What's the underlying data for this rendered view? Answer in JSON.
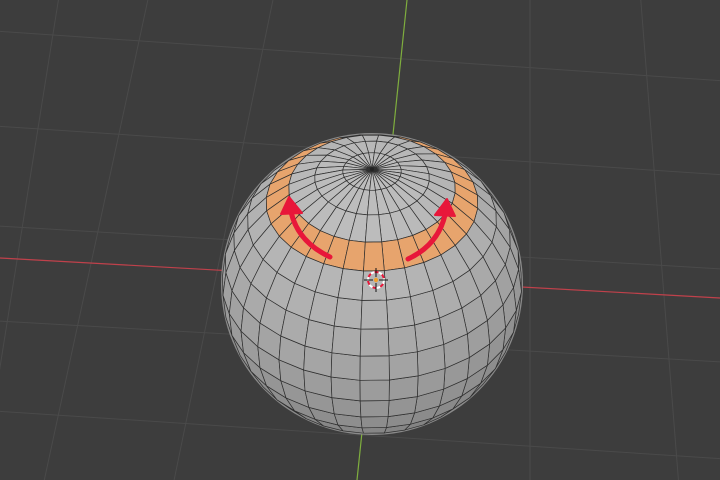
{
  "viewport": {
    "background": "#3d3d3d",
    "grid_color": "#4a4a4a",
    "x_axis_color": "#c0414b",
    "y_axis_color": "#7fae3e"
  },
  "object": {
    "type": "UV sphere",
    "segments": 32,
    "rings": 16,
    "face_color": "#9e9e9e",
    "edge_color": "#2e2e2e",
    "selected_ring_color": "#e7a46d",
    "active_face_color": "#e8e8e8"
  },
  "annotation": {
    "arrow_color": "#e8173a",
    "arrows": [
      {
        "direction": "counter-clockwise"
      },
      {
        "direction": "clockwise"
      }
    ]
  },
  "cursor": {
    "icon": "3d-cursor-icon",
    "colors": [
      "#ffffff",
      "#e8173a"
    ]
  }
}
